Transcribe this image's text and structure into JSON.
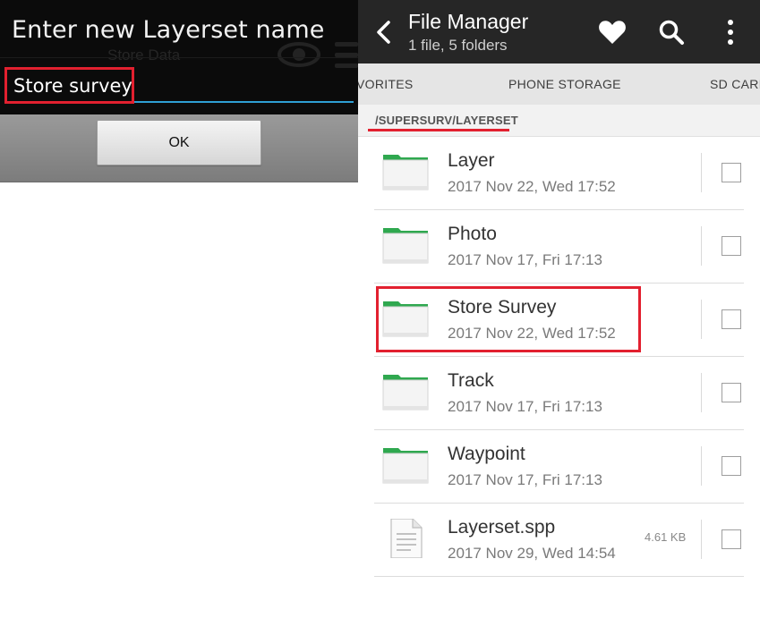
{
  "dialog": {
    "title": "Enter new Layerset name",
    "background_text": "Store Data",
    "input_value": "Store survey",
    "ok_label": "OK"
  },
  "file_manager": {
    "title": "File Manager",
    "subtitle": "1 file, 5 folders",
    "tabs": [
      "VORITES",
      "PHONE STORAGE",
      "SD CARD"
    ],
    "path": "/SUPERSURV/LAYERSET",
    "items": [
      {
        "name": "Layer",
        "date": "2017 Nov 22, Wed 17:52",
        "type": "folder",
        "size": ""
      },
      {
        "name": "Photo",
        "date": "2017 Nov 17, Fri 17:13",
        "type": "folder",
        "size": ""
      },
      {
        "name": "Store Survey",
        "date": "2017 Nov 22, Wed 17:52",
        "type": "folder",
        "size": ""
      },
      {
        "name": "Track",
        "date": "2017 Nov 17, Fri 17:13",
        "type": "folder",
        "size": ""
      },
      {
        "name": "Waypoint",
        "date": "2017 Nov 17, Fri 17:13",
        "type": "folder",
        "size": ""
      },
      {
        "name": "Layerset.spp",
        "date": "2017 Nov 29, Wed 14:54",
        "type": "file",
        "size": "4.61 KB"
      }
    ]
  },
  "colors": {
    "annotation": "#e2202f",
    "folder_tab": "#2fa84f",
    "appbar": "#262626",
    "input_underline": "#2f9fd4"
  },
  "icons": [
    "back-arrow-icon",
    "heart-icon",
    "search-icon",
    "more-vertical-icon",
    "folder-icon",
    "document-icon"
  ]
}
